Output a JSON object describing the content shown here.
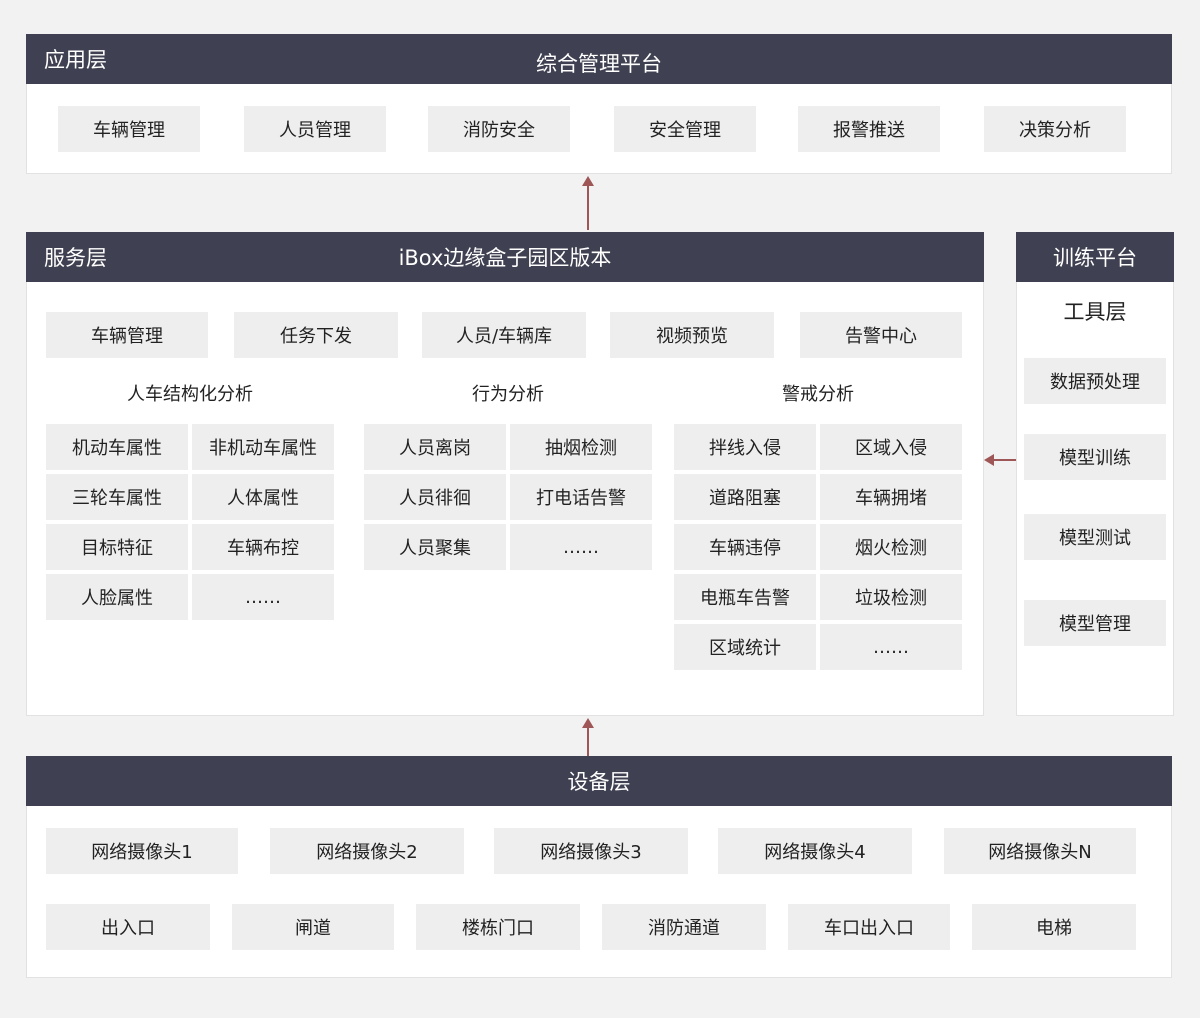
{
  "colors": {
    "bar": "#3f4051",
    "cell": "#eeeeee",
    "arrow": "#9e5656",
    "background": "#f2f2f2"
  },
  "app_layer": {
    "label": "应用层",
    "title": "综合管理平台",
    "items": [
      "车辆管理",
      "人员管理",
      "消防安全",
      "安全管理",
      "报警推送",
      "决策分析"
    ]
  },
  "service_layer": {
    "label": "服务层",
    "title": "iBox边缘盒子园区版本",
    "top_items": [
      "车辆管理",
      "任务下发",
      "人员/车辆库",
      "视频预览",
      "告警中心"
    ],
    "groups": [
      {
        "heading": "人车结构化分析",
        "items": [
          "机动车属性",
          "非机动车属性",
          "三轮车属性",
          "人体属性",
          "目标特征",
          "车辆布控",
          "人脸属性",
          "……"
        ]
      },
      {
        "heading": "行为分析",
        "items": [
          "人员离岗",
          "抽烟检测",
          "人员徘徊",
          "打电话告警",
          "人员聚集",
          "……"
        ]
      },
      {
        "heading": "警戒分析",
        "items": [
          "拌线入侵",
          "区域入侵",
          "道路阻塞",
          "车辆拥堵",
          "车辆违停",
          "烟火检测",
          "电瓶车告警",
          "垃圾检测",
          "区域统计",
          "……"
        ]
      }
    ]
  },
  "training": {
    "title": "训练平台",
    "tools_heading": "工具层",
    "items": [
      "数据预处理",
      "模型训练",
      "模型测试",
      "模型管理"
    ]
  },
  "device_layer": {
    "title": "设备层",
    "cameras": [
      "网络摄像头1",
      "网络摄像头2",
      "网络摄像头3",
      "网络摄像头4",
      "网络摄像头N"
    ],
    "entrances": [
      "出入口",
      "闸道",
      "楼栋门口",
      "消防通道",
      "车口出入口",
      "电梯"
    ]
  }
}
